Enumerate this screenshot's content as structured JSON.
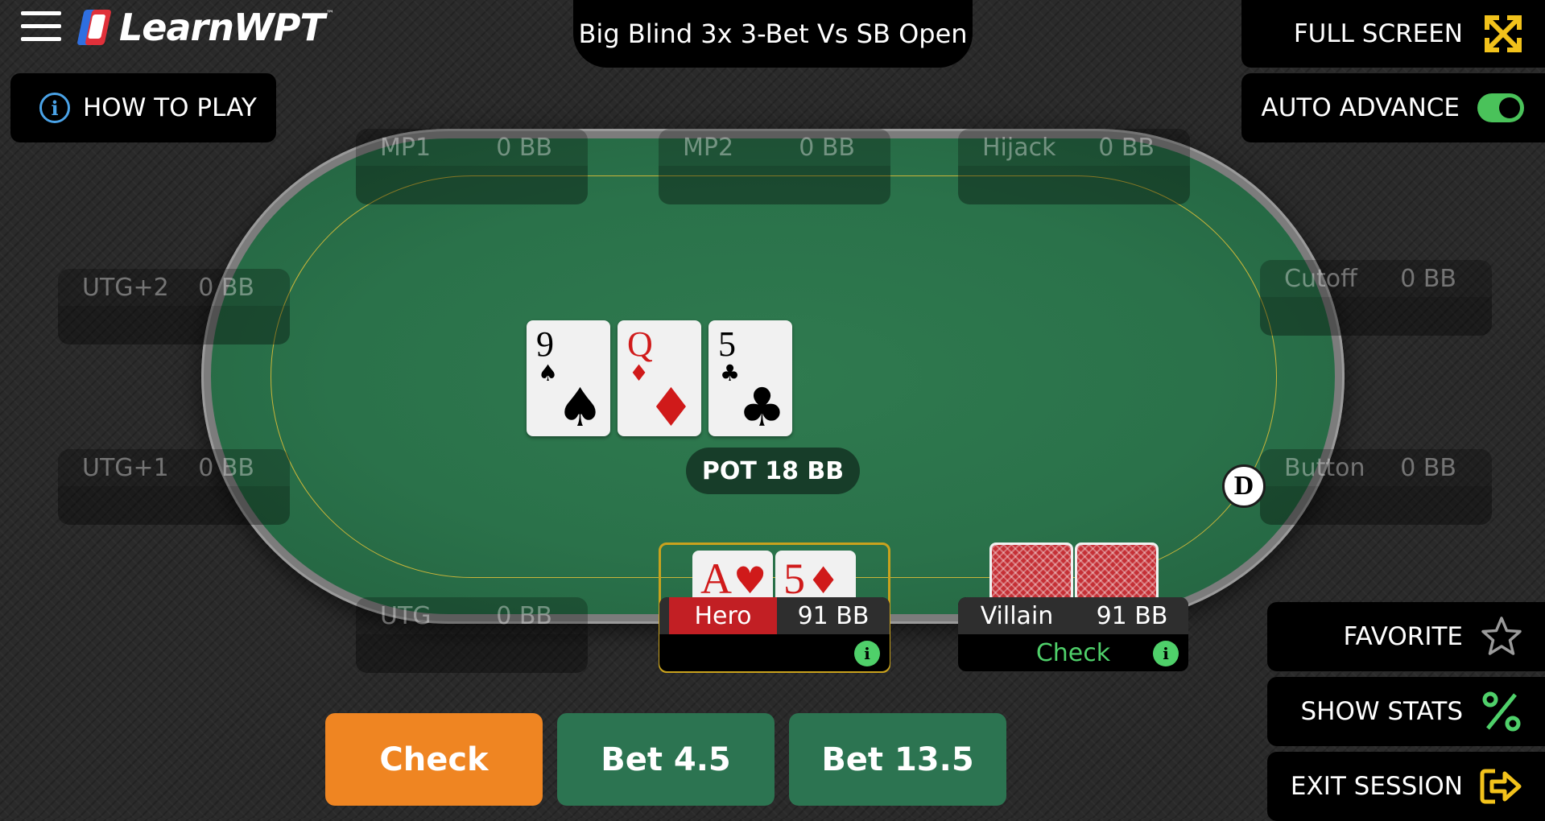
{
  "header": {
    "logo_text": "LearnWPT",
    "logo_tm": "™",
    "title": "Big Blind 3x 3-Bet Vs SB Open",
    "full_screen_label": "FULL SCREEN",
    "auto_advance_label": "AUTO ADVANCE",
    "auto_advance_on": true,
    "how_to_play_label": "HOW TO PLAY"
  },
  "seats": [
    {
      "name": "MP1",
      "stack": "0 BB"
    },
    {
      "name": "MP2",
      "stack": "0 BB"
    },
    {
      "name": "Hijack",
      "stack": "0 BB"
    },
    {
      "name": "UTG+2",
      "stack": "0 BB"
    },
    {
      "name": "Cutoff",
      "stack": "0 BB"
    },
    {
      "name": "UTG+1",
      "stack": "0 BB"
    },
    {
      "name": "Button",
      "stack": "0 BB"
    },
    {
      "name": "UTG",
      "stack": "0 BB"
    }
  ],
  "board": [
    {
      "rank": "9",
      "suit": "♠",
      "color": "#000000"
    },
    {
      "rank": "Q",
      "suit": "♦",
      "color": "#d01a1a"
    },
    {
      "rank": "5",
      "suit": "♣",
      "color": "#000000"
    }
  ],
  "pot_label": "POT 18 BB",
  "dealer_button": "D",
  "hero": {
    "name": "Hero",
    "stack": "91 BB",
    "cards": [
      {
        "rank": "A",
        "suit": "♥"
      },
      {
        "rank": "5",
        "suit": "♦"
      }
    ]
  },
  "villain": {
    "name": "Villain",
    "stack": "91 BB",
    "action": "Check"
  },
  "actions": [
    {
      "label": "Check",
      "color": "#ef8522"
    },
    {
      "label": "Bet 4.5",
      "color": "#2c7451"
    },
    {
      "label": "Bet 13.5",
      "color": "#2c7451"
    }
  ],
  "side_buttons": {
    "favorite_label": "FAVORITE",
    "show_stats_label": "SHOW STATS",
    "exit_session_label": "EXIT SESSION"
  },
  "colors": {
    "accent_yellow": "#f2c21b",
    "accent_green": "#4fd06a",
    "info_blue": "#4aa3e8"
  }
}
